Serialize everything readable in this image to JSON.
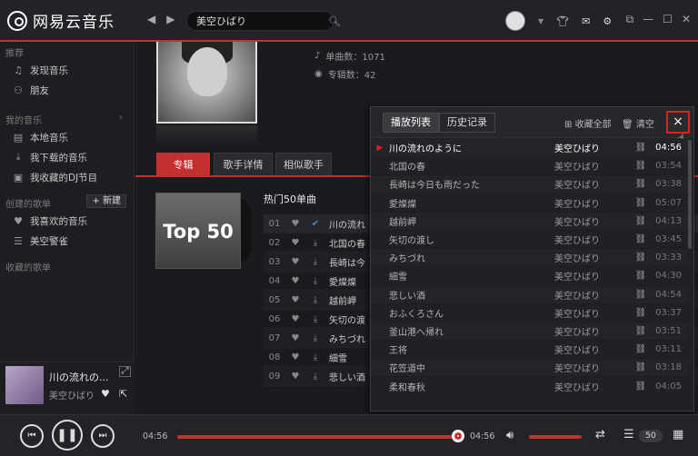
{
  "app": {
    "name": "网易云音乐"
  },
  "search": {
    "value": "美空ひばり"
  },
  "sidebar": {
    "sections": [
      {
        "title": "推荐",
        "items": [
          {
            "label": "发现音乐",
            "icon": "note-icon"
          },
          {
            "label": "朋友",
            "icon": "friends-icon"
          }
        ]
      },
      {
        "title": "我的音乐",
        "items": [
          {
            "label": "本地音乐",
            "icon": "local-icon"
          },
          {
            "label": "我下载的音乐",
            "icon": "download-icon"
          },
          {
            "label": "我收藏的DJ节目",
            "icon": "radio-icon"
          }
        ]
      },
      {
        "title": "创建的歌单",
        "new_label": "+ 新建",
        "items": [
          {
            "label": "我喜欢的音乐",
            "icon": "heart-icon"
          },
          {
            "label": "美空警雀",
            "icon": "playlist-icon"
          }
        ]
      },
      {
        "title": "收藏的歌单",
        "items": []
      }
    ]
  },
  "now_playing": {
    "title": "川の流れの...",
    "artist": "美空ひばり"
  },
  "artist": {
    "song_count_label": "单曲数：1071",
    "album_count_label": "专辑数：42"
  },
  "tabs": [
    "专辑",
    "歌手详情",
    "相似歌手"
  ],
  "top50": {
    "cover_text": "Top 50",
    "section_title": "热门50单曲"
  },
  "songs": [
    {
      "idx": "01",
      "name": "川の流れ"
    },
    {
      "idx": "02",
      "name": "北国の春"
    },
    {
      "idx": "03",
      "name": "長崎は今"
    },
    {
      "idx": "04",
      "name": "愛燦燦"
    },
    {
      "idx": "05",
      "name": "越前岬"
    },
    {
      "idx": "06",
      "name": "矢切の渡"
    },
    {
      "idx": "07",
      "name": "みちづれ"
    },
    {
      "idx": "08",
      "name": "細雪"
    },
    {
      "idx": "09",
      "name": "悲しい酒"
    }
  ],
  "popup": {
    "tab_playlist": "播放列表",
    "tab_history": "历史记录",
    "collect_all": "收藏全部",
    "clear": "清空",
    "close": "×",
    "items": [
      {
        "name": "川の流れのように",
        "artist": "美空ひばり",
        "dur": "04:56",
        "current": true
      },
      {
        "name": "北国の春",
        "artist": "美空ひばり",
        "dur": "03:54"
      },
      {
        "name": "長崎は今日も雨だった",
        "artist": "美空ひばり",
        "dur": "03:38"
      },
      {
        "name": "愛燦燦",
        "artist": "美空ひばり",
        "dur": "05:07"
      },
      {
        "name": "越前岬",
        "artist": "美空ひばり",
        "dur": "04:13"
      },
      {
        "name": "矢切の渡し",
        "artist": "美空ひばり",
        "dur": "03:45"
      },
      {
        "name": "みちづれ",
        "artist": "美空ひばり",
        "dur": "03:33"
      },
      {
        "name": "細雪",
        "artist": "美空ひばり",
        "dur": "04:30"
      },
      {
        "name": "悲しい酒",
        "artist": "美空ひばり",
        "dur": "04:54"
      },
      {
        "name": "おふくろさん",
        "artist": "美空ひばり",
        "dur": "03:37"
      },
      {
        "name": "釜山港へ帰れ",
        "artist": "美空ひばり",
        "dur": "03:51"
      },
      {
        "name": "王将",
        "artist": "美空ひばり",
        "dur": "03:11"
      },
      {
        "name": "花笠道中",
        "artist": "美空ひばり",
        "dur": "03:18"
      },
      {
        "name": "柔和春秋",
        "artist": "美空ひばり",
        "dur": "04:05"
      }
    ]
  },
  "player": {
    "time_current": "04:56",
    "time_total": "04:56",
    "queue_count": "50",
    "progress": 1.0,
    "volume": 1.0
  }
}
